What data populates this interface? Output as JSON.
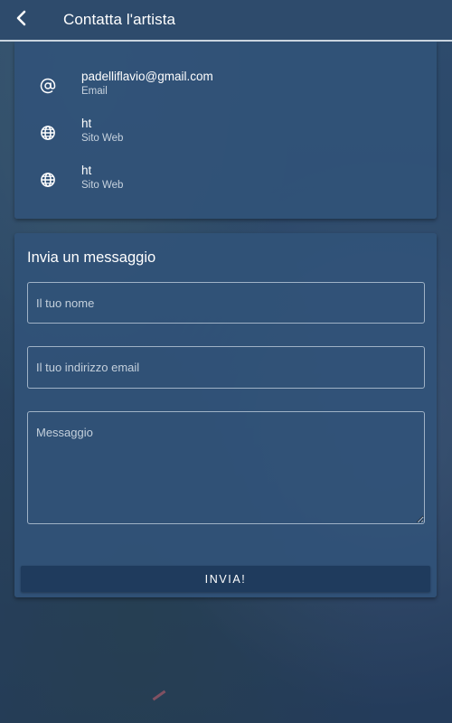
{
  "appbar": {
    "back_icon": "chevron-left-icon",
    "title": "Contatta l'artista"
  },
  "contact_info": {
    "items": [
      {
        "icon": "at-sign-icon",
        "value": "padelliflavio@gmail.com",
        "caption": "Email"
      },
      {
        "icon": "globe-icon",
        "value": "ht",
        "caption": "Sito Web"
      },
      {
        "icon": "globe-icon",
        "value": "ht",
        "caption": "Sito Web"
      }
    ]
  },
  "message_form": {
    "title": "Invia un messaggio",
    "name_placeholder": "Il tuo nome",
    "email_placeholder": "Il tuo indirizzo email",
    "message_placeholder": "Messaggio",
    "submit_label": "INVIA!"
  },
  "colors": {
    "appbar": "#2e4b6c",
    "card": "#315278",
    "button": "#1f3b5d",
    "text": "#ffffff"
  }
}
